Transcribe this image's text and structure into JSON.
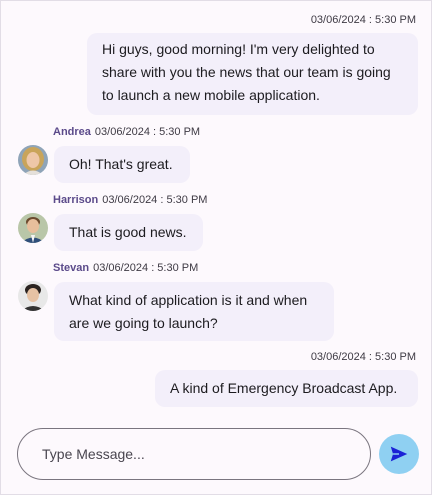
{
  "messages": [
    {
      "timestamp": "03/06/2024 : 5:30 PM",
      "lines": [
        "Hi guys, good morning! I'm very delighted to",
        "share with you the news that our team is going",
        "to launch a new mobile application."
      ]
    },
    {
      "author": "Andrea",
      "timestamp": "03/06/2024 : 5:30 PM",
      "lines": [
        "Oh! That's great."
      ]
    },
    {
      "author": "Harrison",
      "timestamp": "03/06/2024 : 5:30 PM",
      "lines": [
        "That is good news."
      ]
    },
    {
      "author": "Stevan",
      "timestamp": "03/06/2024 : 5:30 PM",
      "lines": [
        "What kind of application is it and when",
        "are we going to launch?"
      ]
    },
    {
      "timestamp": "03/06/2024 : 5:30 PM",
      "lines": [
        "A kind of Emergency Broadcast App."
      ]
    }
  ],
  "composer": {
    "placeholder": "Type Message...",
    "send_icon": "send-icon"
  },
  "colors": {
    "background": "#fdf9fd",
    "bubble": "#f3effa",
    "author": "#5b4a8a",
    "send_button": "#8fd0f2",
    "send_icon": "#1b22d6"
  }
}
